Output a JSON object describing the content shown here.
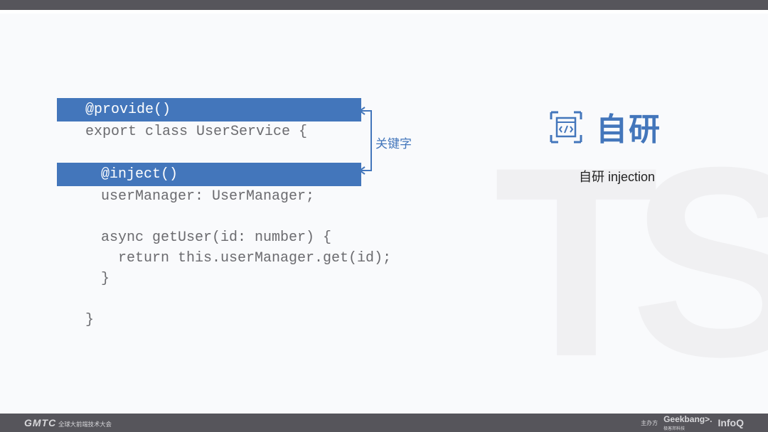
{
  "watermark": "TS",
  "code": {
    "line1": "@provide()",
    "line2": "export class UserService {",
    "line3": "@inject()",
    "line4": "userManager: UserManager;",
    "line5": "async getUser(id: number) {",
    "line6": "  return this.userManager.get(id);",
    "line7": "}",
    "line8": "}"
  },
  "keyword_label": "关键字",
  "side": {
    "title": "自研",
    "subtitle": "自研 injection"
  },
  "footer": {
    "left_brand": "GMTC",
    "left_sub": "全球大前端技术大会",
    "right_tiny": "主办方",
    "right_gb": "Geekbang>.",
    "right_gb_sub": "极客邦科技",
    "right_iq": "InfoQ"
  }
}
